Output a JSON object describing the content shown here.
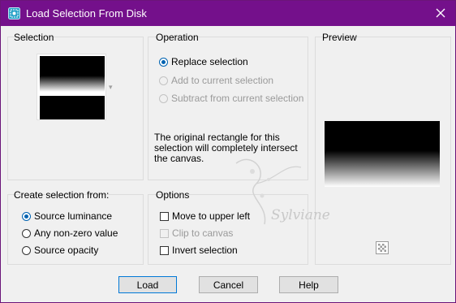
{
  "window": {
    "title": "Load Selection From Disk",
    "accent_color": "#74108b"
  },
  "selection_group": {
    "label": "Selection"
  },
  "operation_group": {
    "label": "Operation",
    "options": [
      {
        "label": "Replace selection",
        "selected": true,
        "enabled": true
      },
      {
        "label": "Add to current selection",
        "selected": false,
        "enabled": false
      },
      {
        "label": "Subtract from current selection",
        "selected": false,
        "enabled": false
      }
    ],
    "info_text": "The original rectangle for this selection will completely intersect the canvas."
  },
  "preview_group": {
    "label": "Preview"
  },
  "create_group": {
    "label": "Create selection from:",
    "options": [
      {
        "label": "Source luminance",
        "selected": true
      },
      {
        "label": "Any non-zero value",
        "selected": false
      },
      {
        "label": "Source opacity",
        "selected": false
      }
    ]
  },
  "options_group": {
    "label": "Options",
    "checks": [
      {
        "label": "Move to upper left",
        "checked": false,
        "enabled": true
      },
      {
        "label": "Clip to canvas",
        "checked": false,
        "enabled": false
      },
      {
        "label": "Invert selection",
        "checked": false,
        "enabled": true
      }
    ]
  },
  "buttons": {
    "load": "Load",
    "cancel": "Cancel",
    "help": "Help"
  },
  "watermark": {
    "text": "Sylviane"
  },
  "icons": {
    "app": "selection-app-icon",
    "close": "close-icon",
    "dropdown": "chevron-down-icon",
    "checker": "checkerboard-icon"
  }
}
